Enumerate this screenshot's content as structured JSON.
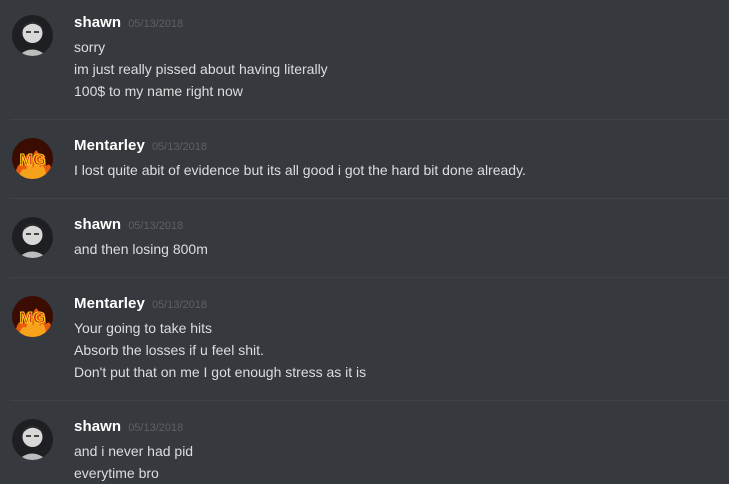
{
  "messages": [
    {
      "author": "shawn",
      "timestamp": "05/13/2018",
      "avatar": "shawn-avatar",
      "lines": [
        "sorry",
        "im just really pissed about having literally",
        "100$ to my name right now"
      ]
    },
    {
      "author": "Mentarley",
      "timestamp": "05/13/2018",
      "avatar": "mentarley-avatar",
      "lines": [
        "I lost quite abit of evidence but its all good i got the hard bit done already."
      ]
    },
    {
      "author": "shawn",
      "timestamp": "05/13/2018",
      "avatar": "shawn-avatar",
      "lines": [
        "and then losing 800m"
      ]
    },
    {
      "author": "Mentarley",
      "timestamp": "05/13/2018",
      "avatar": "mentarley-avatar",
      "lines": [
        "Your going to take hits",
        "Absorb the losses if u feel shit.",
        "Don't put that on me I got enough stress as it is"
      ]
    },
    {
      "author": "shawn",
      "timestamp": "05/13/2018",
      "avatar": "shawn-avatar",
      "lines": [
        "and i never had pid",
        "everytime bro"
      ]
    }
  ],
  "avatar_logo_text": "MG",
  "colors": {
    "background": "#36393e",
    "username": "#ffffff",
    "timestamp": "#5d6066",
    "message_text": "#dcddde",
    "divider": "#3f4247"
  }
}
